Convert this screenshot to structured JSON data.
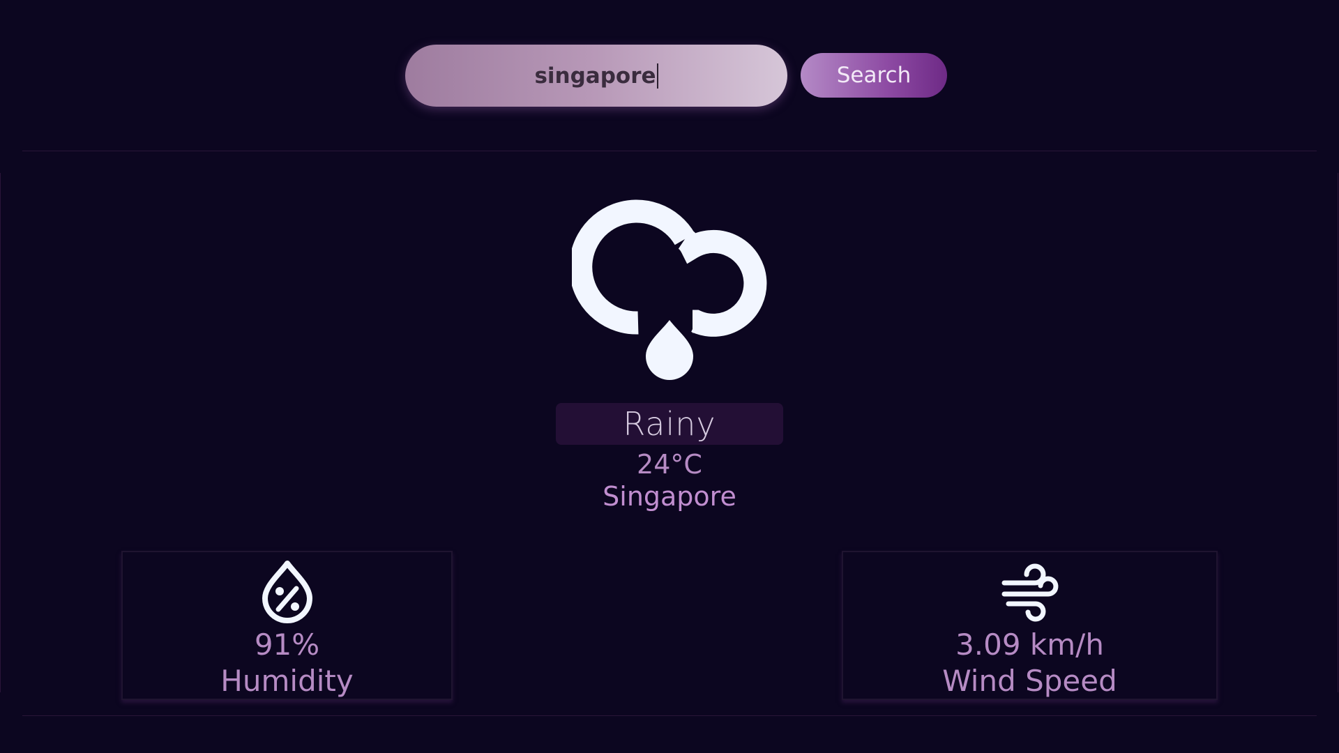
{
  "search": {
    "value": "singapore",
    "button_label": "Search"
  },
  "weather": {
    "condition": "Rainy",
    "temperature": "24°C",
    "city": "Singapore",
    "icon": "rain-cloud-icon"
  },
  "cards": {
    "humidity": {
      "value": "91%",
      "label": "Humidity",
      "icon": "humidity-drop-icon"
    },
    "wind": {
      "value": "3.09 km/h",
      "label": "Wind Speed",
      "icon": "wind-icon"
    }
  },
  "colors": {
    "background": "#0c0620",
    "accent": "#b68bc4",
    "icon": "#f2f6ff"
  }
}
